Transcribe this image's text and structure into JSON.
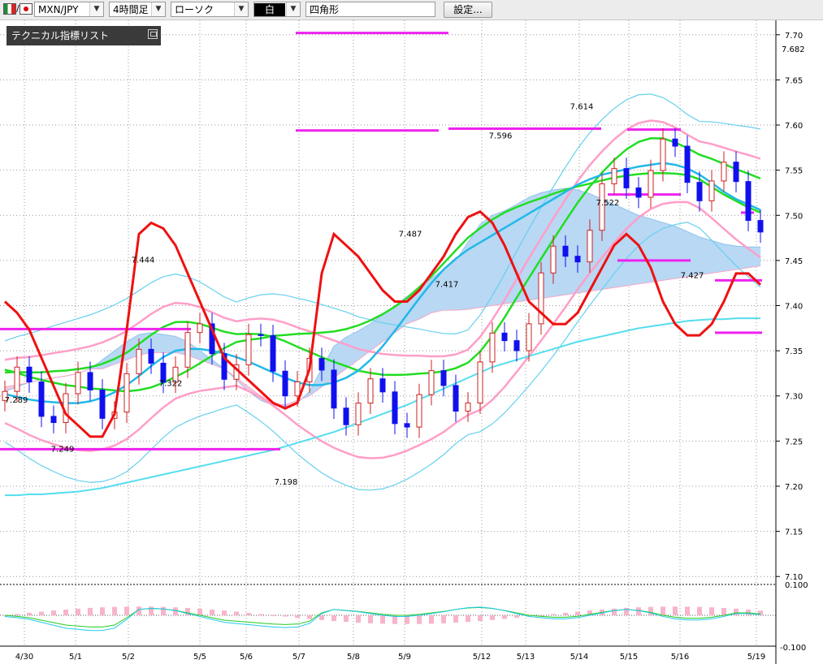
{
  "toolbar": {
    "symbol": "MXN/JPY",
    "timeframe": "4時間足",
    "chart_type": "ローソク",
    "color_mode": "白",
    "shape": "四角形",
    "settings_label": "設定..."
  },
  "indicator_panel": {
    "title": "テクニカル指標リスト"
  },
  "colors": {
    "bull": "#cc2222",
    "bear": "#1010ee",
    "bb_inner": "#ff9ec8",
    "bb_outer": "#66d0ee",
    "ma_mid": "#22dd22",
    "ma_fast": "#22b8e8",
    "ma_slow": "#55ddee",
    "rsi": "#ee1111",
    "level": "#ee22ee",
    "cloud_up": "#b8d8f4",
    "cloud_dn": "#f8c8dc"
  },
  "chart_data": {
    "type": "candlestick",
    "symbol": "MXN/JPY",
    "timeframe": "4時間足",
    "x_labels": [
      "4/30",
      "5/1",
      "5/2",
      "5/5",
      "5/6",
      "5/7",
      "5/8",
      "5/9",
      "5/12",
      "5/13",
      "5/14",
      "5/15",
      "5/16",
      "5/19"
    ],
    "y_ticks": [
      "7.70",
      "7.65",
      "7.60",
      "7.55",
      "7.50",
      "7.45",
      "7.40",
      "7.35",
      "7.30",
      "7.25",
      "7.20",
      "7.15",
      "7.10"
    ],
    "ylim": [
      7.093,
      7.716
    ],
    "last_price_label": "7.682",
    "annotations": [
      {
        "text": "7.289",
        "value": 7.289
      },
      {
        "text": "7.249",
        "value": 7.249
      },
      {
        "text": "7.444",
        "value": 7.444
      },
      {
        "text": "7.322",
        "value": 7.322
      },
      {
        "text": "7.198",
        "value": 7.198
      },
      {
        "text": "7.487",
        "value": 7.487
      },
      {
        "text": "7.417",
        "value": 7.417
      },
      {
        "text": "7.596",
        "value": 7.596
      },
      {
        "text": "7.614",
        "value": 7.614
      },
      {
        "text": "7.522",
        "value": 7.522
      },
      {
        "text": "7.427",
        "value": 7.427
      }
    ],
    "bb_mid": [
      7.305,
      7.303,
      7.3,
      7.298,
      7.297,
      7.296,
      7.296,
      7.297,
      7.3,
      7.305,
      7.312,
      7.322,
      7.333,
      7.343,
      7.35,
      7.352,
      7.352,
      7.35,
      7.348,
      7.347,
      7.345,
      7.342,
      7.337,
      7.33,
      7.322,
      7.315,
      7.308,
      7.302,
      7.297,
      7.292,
      7.29,
      7.289,
      7.29,
      7.292,
      7.295,
      7.298,
      7.302,
      7.308,
      7.315,
      7.325,
      7.34,
      7.358,
      7.378,
      7.398,
      7.418,
      7.438,
      7.458,
      7.478,
      7.496,
      7.512,
      7.527,
      7.54,
      7.55,
      7.556,
      7.558,
      7.556,
      7.552,
      7.545,
      7.538,
      7.53,
      7.522,
      7.515,
      7.508
    ],
    "ichimoku_a": [
      7.305,
      7.31,
      7.315,
      7.318,
      7.32,
      7.322,
      7.325,
      7.33,
      7.34,
      7.35,
      7.36,
      7.368,
      7.37,
      7.368,
      7.366,
      7.36,
      7.35,
      7.34,
      7.33,
      7.318,
      7.305,
      7.295,
      7.29,
      7.288,
      7.292,
      7.305,
      7.33,
      7.355,
      7.365,
      7.372,
      7.38,
      7.39,
      7.4,
      7.41,
      7.42,
      7.43,
      7.44,
      7.45,
      7.47,
      7.49,
      7.5,
      7.505,
      7.512,
      7.52,
      7.525,
      7.528,
      7.53,
      7.528,
      7.524,
      7.518,
      7.512,
      7.506,
      7.5,
      7.496,
      7.492,
      7.488,
      7.482,
      7.476,
      7.472,
      7.468,
      7.466,
      7.465,
      7.465
    ],
    "ichimoku_b": [
      7.31,
      7.312,
      7.315,
      7.318,
      7.32,
      7.322,
      7.325,
      7.33,
      7.33,
      7.335,
      7.34,
      7.345,
      7.348,
      7.348,
      7.348,
      7.345,
      7.34,
      7.335,
      7.33,
      7.32,
      7.31,
      7.3,
      7.292,
      7.29,
      7.295,
      7.3,
      7.31,
      7.32,
      7.33,
      7.34,
      7.35,
      7.36,
      7.37,
      7.38,
      7.385,
      7.392,
      7.395,
      7.395,
      7.396,
      7.398,
      7.4,
      7.402,
      7.404,
      7.406,
      7.408,
      7.41,
      7.412,
      7.414,
      7.416,
      7.418,
      7.42,
      7.422,
      7.424,
      7.426,
      7.428,
      7.43,
      7.432,
      7.434,
      7.436,
      7.438,
      7.44,
      7.442,
      7.444
    ],
    "ma_fast": [
      7.302,
      7.299,
      7.296,
      7.294,
      7.293,
      7.292,
      7.292,
      7.294,
      7.298,
      7.304,
      7.312,
      7.322,
      7.333,
      7.343,
      7.35,
      7.352,
      7.352,
      7.35,
      7.347,
      7.343,
      7.338,
      7.332,
      7.326,
      7.32,
      7.315,
      7.312,
      7.312,
      7.315,
      7.32,
      7.328,
      7.34,
      7.355,
      7.372,
      7.39,
      7.408,
      7.425,
      7.44,
      7.452,
      7.462,
      7.47,
      7.478,
      7.486,
      7.494,
      7.502,
      7.51,
      7.518,
      7.526,
      7.534,
      7.54,
      7.545,
      7.548,
      7.551,
      7.554,
      7.556,
      7.558,
      7.556,
      7.552,
      7.545,
      7.536,
      7.526,
      7.518,
      7.512,
      7.506
    ],
    "ma_mid": [
      7.35,
      7.349,
      7.347,
      7.346,
      7.345,
      7.344,
      7.344,
      7.343,
      7.343,
      7.342,
      7.341,
      7.342,
      7.344,
      7.348,
      7.353,
      7.358,
      7.364,
      7.37,
      7.376,
      7.381,
      7.386,
      7.39,
      7.395,
      7.398,
      7.401,
      7.403,
      7.405,
      7.407,
      7.41,
      7.414,
      7.419,
      7.425,
      7.432,
      7.44,
      7.45,
      7.46,
      7.472,
      7.484,
      7.497,
      7.51,
      7.522,
      7.532,
      7.54,
      7.547,
      7.553,
      7.559,
      7.564,
      7.568,
      7.571,
      7.574,
      7.576,
      7.577,
      7.577,
      7.576,
      7.574,
      7.571,
      7.567,
      7.562,
      7.556,
      7.55,
      7.545,
      7.54,
      7.536
    ],
    "ma_slow": [
      7.19,
      7.19,
      7.191,
      7.191,
      7.192,
      7.193,
      7.194,
      7.196,
      7.198,
      7.201,
      7.204,
      7.207,
      7.21,
      7.213,
      7.216,
      7.219,
      7.222,
      7.225,
      7.228,
      7.231,
      7.234,
      7.237,
      7.24,
      7.244,
      7.248,
      7.252,
      7.256,
      7.26,
      7.265,
      7.27,
      7.275,
      7.28,
      7.285,
      7.29,
      7.296,
      7.302,
      7.308,
      7.314,
      7.32,
      7.326,
      7.332,
      7.336,
      7.34,
      7.344,
      7.348,
      7.352,
      7.356,
      7.36,
      7.363,
      7.366,
      7.369,
      7.372,
      7.375,
      7.377,
      7.379,
      7.381,
      7.383,
      7.384,
      7.385,
      7.385,
      7.386,
      7.386,
      7.386
    ],
    "rsi": [
      50,
      48,
      45,
      40,
      35,
      30,
      28,
      26,
      26,
      30,
      45,
      62,
      64,
      63,
      60,
      55,
      50,
      45,
      40,
      38,
      36,
      34,
      32,
      31,
      32,
      38,
      55,
      62,
      60,
      58,
      55,
      52,
      50,
      50,
      52,
      55,
      58,
      62,
      65,
      66,
      64,
      60,
      55,
      50,
      48,
      46,
      46,
      48,
      52,
      56,
      60,
      62,
      60,
      56,
      50,
      46,
      44,
      44,
      46,
      50,
      55,
      55,
      53
    ]
  },
  "sub_chart": {
    "y_top_label": "0.100",
    "y_bottom_label": "-0.100",
    "ylim": [
      -0.1,
      0.1
    ]
  }
}
